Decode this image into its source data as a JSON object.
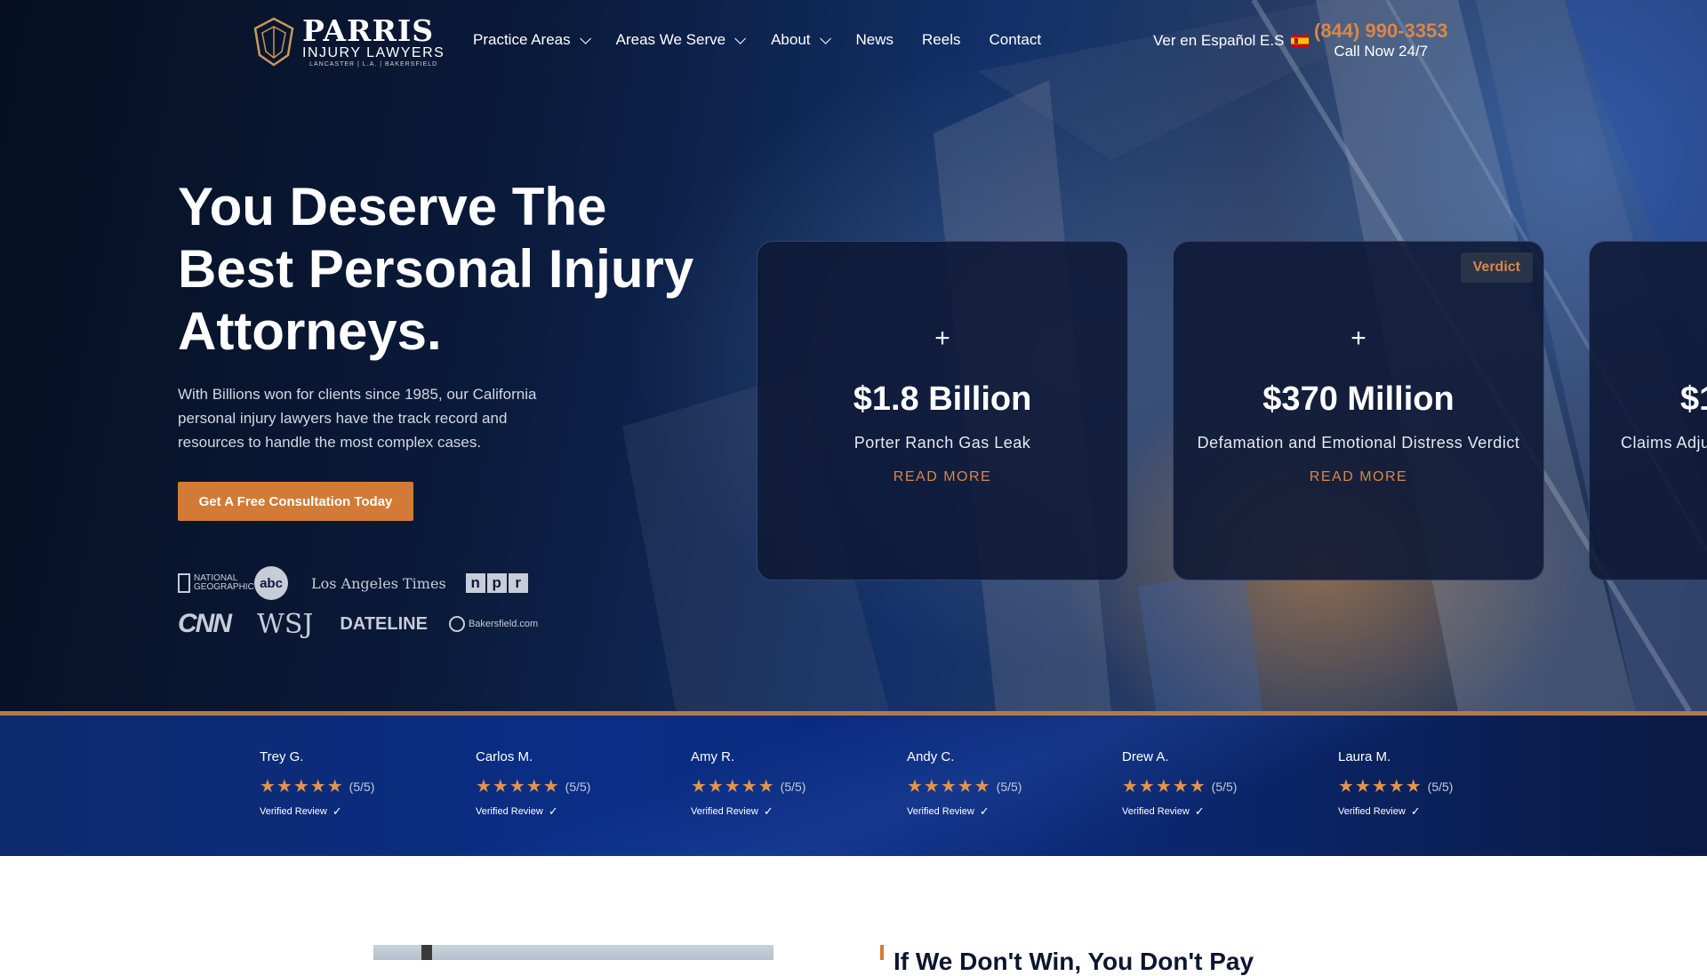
{
  "header": {
    "logo": {
      "name": "PARRIS",
      "subtitle": "INJURY LAWYERS",
      "locations": "LANCASTER | L.A. | BAKERSFIELD"
    },
    "nav": [
      {
        "label": "Practice Areas",
        "has_dropdown": true
      },
      {
        "label": "Areas We Serve",
        "has_dropdown": true
      },
      {
        "label": "About",
        "has_dropdown": true
      },
      {
        "label": "News",
        "has_dropdown": false
      },
      {
        "label": "Reels",
        "has_dropdown": false
      },
      {
        "label": "Contact",
        "has_dropdown": false
      }
    ],
    "language_link": "Ver en Español E.S",
    "phone": "(844) 990-3353",
    "phone_caption": "Call Now 24/7"
  },
  "hero": {
    "headline": "You Deserve The Best Personal Injury Attorneys.",
    "lead": "With Billions won for clients since 1985, our California personal injury lawyers have the track record and resources to handle the most complex cases.",
    "cta": "Get A Free Consultation Today",
    "media": {
      "natgeo_line1": "NATIONAL",
      "natgeo_line2": "GEOGRAPHIC",
      "abc": "abc",
      "latimes": "Los Angeles Times",
      "npr": [
        "n",
        "p",
        "r"
      ],
      "cnn": "CNN",
      "wsj": "WSJ",
      "dateline": "DATELINE",
      "bakersfield": "Bakersfield.com"
    }
  },
  "results": [
    {
      "plus": "+",
      "amount": "$1.8 Billion",
      "case": "Porter Ranch Gas Leak",
      "link": "READ MORE",
      "badge": ""
    },
    {
      "plus": "+",
      "amount": "$370 Million",
      "case": "Defamation and Emotional Distress Verdict",
      "link": "READ MORE",
      "badge": "Verdict"
    },
    {
      "plus": "",
      "amount": "$1",
      "case": "Claims Adju",
      "link": "",
      "badge": ""
    }
  ],
  "reviews": [
    {
      "name": "Trey G.",
      "stars": "★★★★★",
      "score": "(5/5)",
      "verified": "Verified Review",
      "check": "✓"
    },
    {
      "name": "Carlos M.",
      "stars": "★★★★★",
      "score": "(5/5)",
      "verified": "Verified Review",
      "check": "✓"
    },
    {
      "name": "Amy R.",
      "stars": "★★★★★",
      "score": "(5/5)",
      "verified": "Verified Review",
      "check": "✓"
    },
    {
      "name": "Andy C.",
      "stars": "★★★★★",
      "score": "(5/5)",
      "verified": "Verified Review",
      "check": "✓"
    },
    {
      "name": "Drew A.",
      "stars": "★★★★★",
      "score": "(5/5)",
      "verified": "Verified Review",
      "check": "✓"
    },
    {
      "name": "Laura M.",
      "stars": "★★★★★",
      "score": "(5/5)",
      "verified": "Verified Review",
      "check": "✓"
    }
  ],
  "next_section": {
    "title": "If We Don't Win, You Don't Pay"
  },
  "colors": {
    "accent": "#d27a36",
    "phone": "#d9874a",
    "stars": "#e1944c",
    "navy": "#0a1a3a"
  },
  "icons": [
    "logo-emblem-icon",
    "chevron-down-icon",
    "spain-flag-icon",
    "star-icon",
    "checkmark-icon"
  ]
}
